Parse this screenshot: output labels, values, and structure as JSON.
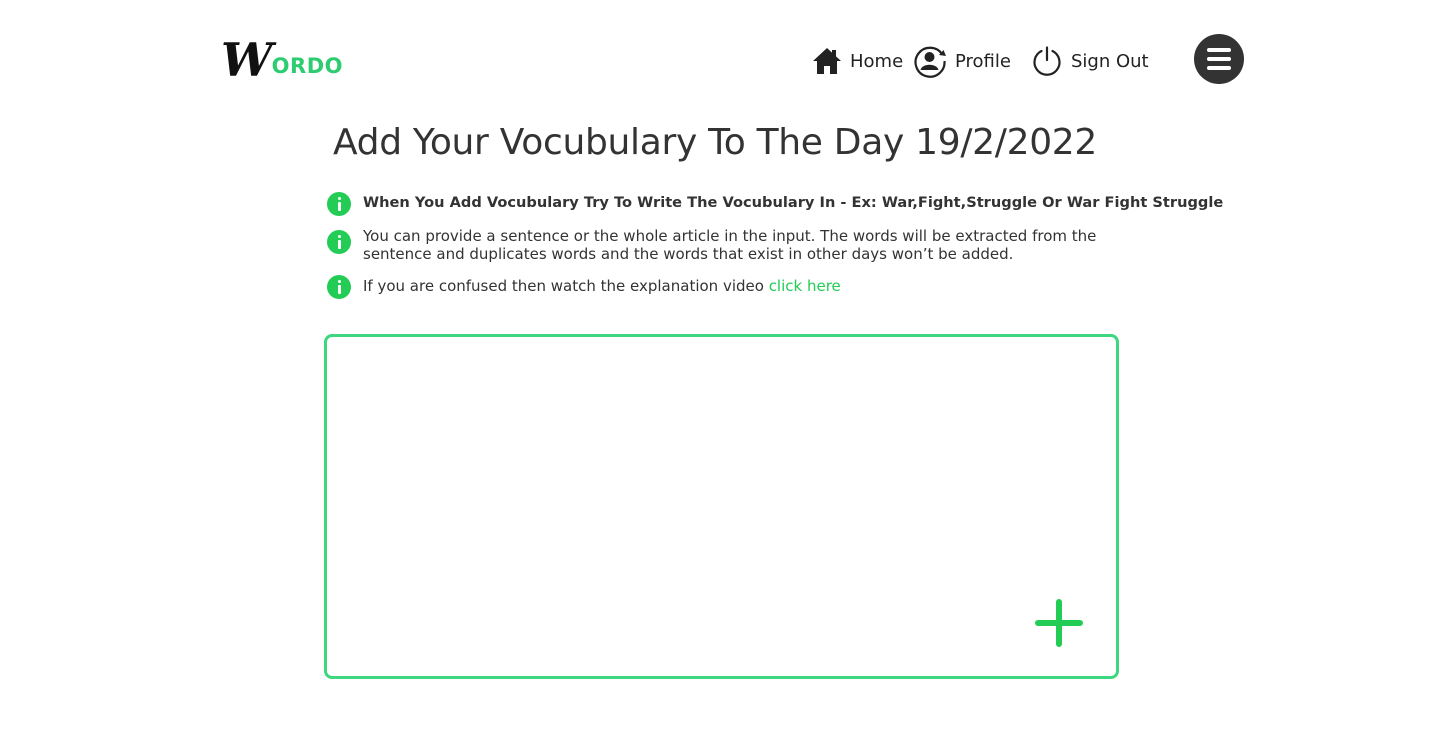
{
  "brand": {
    "logo_letter": "W",
    "logo_rest": "ORDO",
    "accent_color": "#2ecc71"
  },
  "nav": {
    "home_label": "Home",
    "profile_label": "Profile",
    "signout_label": "Sign Out",
    "icons": {
      "home": "home-icon",
      "profile": "profile-icon",
      "signout": "power-icon",
      "menu": "menu-icon"
    }
  },
  "page": {
    "title": "Add Your Vocubulary To The Day 19/2/2022"
  },
  "info": {
    "line1": "When You Add Vocubulary Try To Write The Vocubulary In - Ex: War,Fight,Struggle Or War Fight Struggle",
    "line2": "You can provide a sentence or the whole article in the input. The words will be extracted from the sentence and duplicates words and the words that exist in other days won’t be added.",
    "line3_text": "If you are confused then watch the explanation video ",
    "line3_link": "click here"
  },
  "input": {
    "value": "",
    "placeholder": ""
  },
  "colors": {
    "accent": "#22cc55",
    "border": "#3ed67f",
    "text": "#333333",
    "menu_bg": "#333333"
  }
}
